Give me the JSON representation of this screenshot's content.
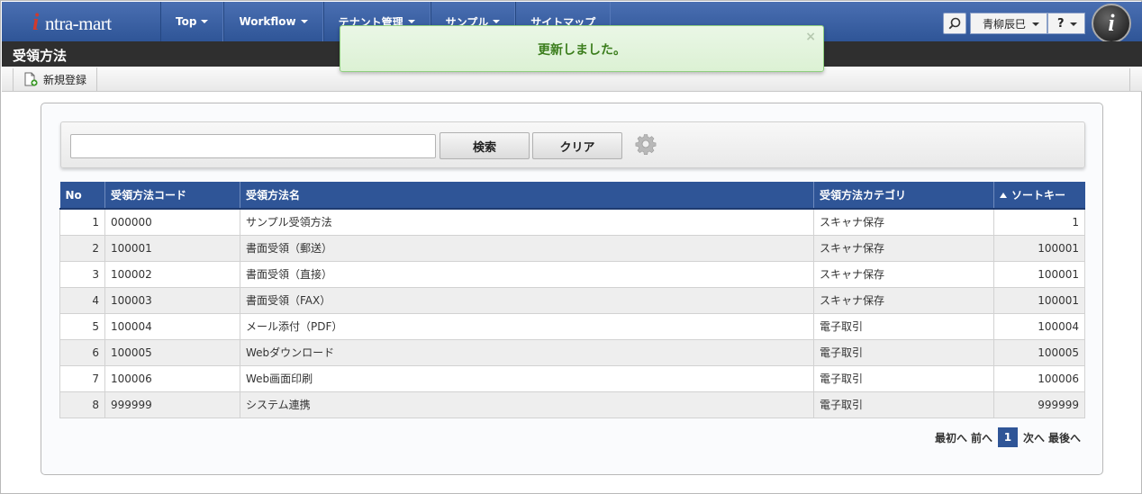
{
  "header": {
    "logo_text": "ntra-mart",
    "logo_mark": "i",
    "nav": [
      {
        "label": "Top"
      },
      {
        "label": "Workflow"
      },
      {
        "label": "テナント管理"
      },
      {
        "label": "サンプル"
      },
      {
        "label": "サイトマップ"
      }
    ],
    "user_name": "青柳辰巳",
    "help_label": "?",
    "badge_letter": "i"
  },
  "page": {
    "title": "受領方法"
  },
  "toolbar": {
    "new_label": "新規登録"
  },
  "toast": {
    "message": "更新しました。",
    "close": "×"
  },
  "search": {
    "value": "",
    "search_label": "検索",
    "clear_label": "クリア"
  },
  "table": {
    "columns": [
      "No",
      "受領方法コード",
      "受領方法名",
      "受領方法カテゴリ",
      "ソートキー"
    ],
    "rows": [
      {
        "no": "1",
        "code": "000000",
        "name": "サンプル受領方法",
        "category": "スキャナ保存",
        "sort": "1"
      },
      {
        "no": "2",
        "code": "100001",
        "name": "書面受領（郵送）",
        "category": "スキャナ保存",
        "sort": "100001"
      },
      {
        "no": "3",
        "code": "100002",
        "name": "書面受領（直接）",
        "category": "スキャナ保存",
        "sort": "100001"
      },
      {
        "no": "4",
        "code": "100003",
        "name": "書面受領（FAX）",
        "category": "スキャナ保存",
        "sort": "100001"
      },
      {
        "no": "5",
        "code": "100004",
        "name": "メール添付（PDF）",
        "category": "電子取引",
        "sort": "100004"
      },
      {
        "no": "6",
        "code": "100005",
        "name": "Webダウンロード",
        "category": "電子取引",
        "sort": "100005"
      },
      {
        "no": "7",
        "code": "100006",
        "name": "Web画面印刷",
        "category": "電子取引",
        "sort": "100006"
      },
      {
        "no": "8",
        "code": "999999",
        "name": "システム連携",
        "category": "電子取引",
        "sort": "999999"
      }
    ]
  },
  "pager": {
    "first": "最初へ",
    "prev": "前へ",
    "current": "1",
    "next": "次へ",
    "last": "最後へ"
  },
  "colors": {
    "header_blue": "#2f5597",
    "toast_green": "#3b7d1c",
    "title_bar": "#2f2f2f"
  },
  "icons": {
    "search": "search-icon",
    "settings": "gear-icon",
    "new": "new-document-icon"
  }
}
